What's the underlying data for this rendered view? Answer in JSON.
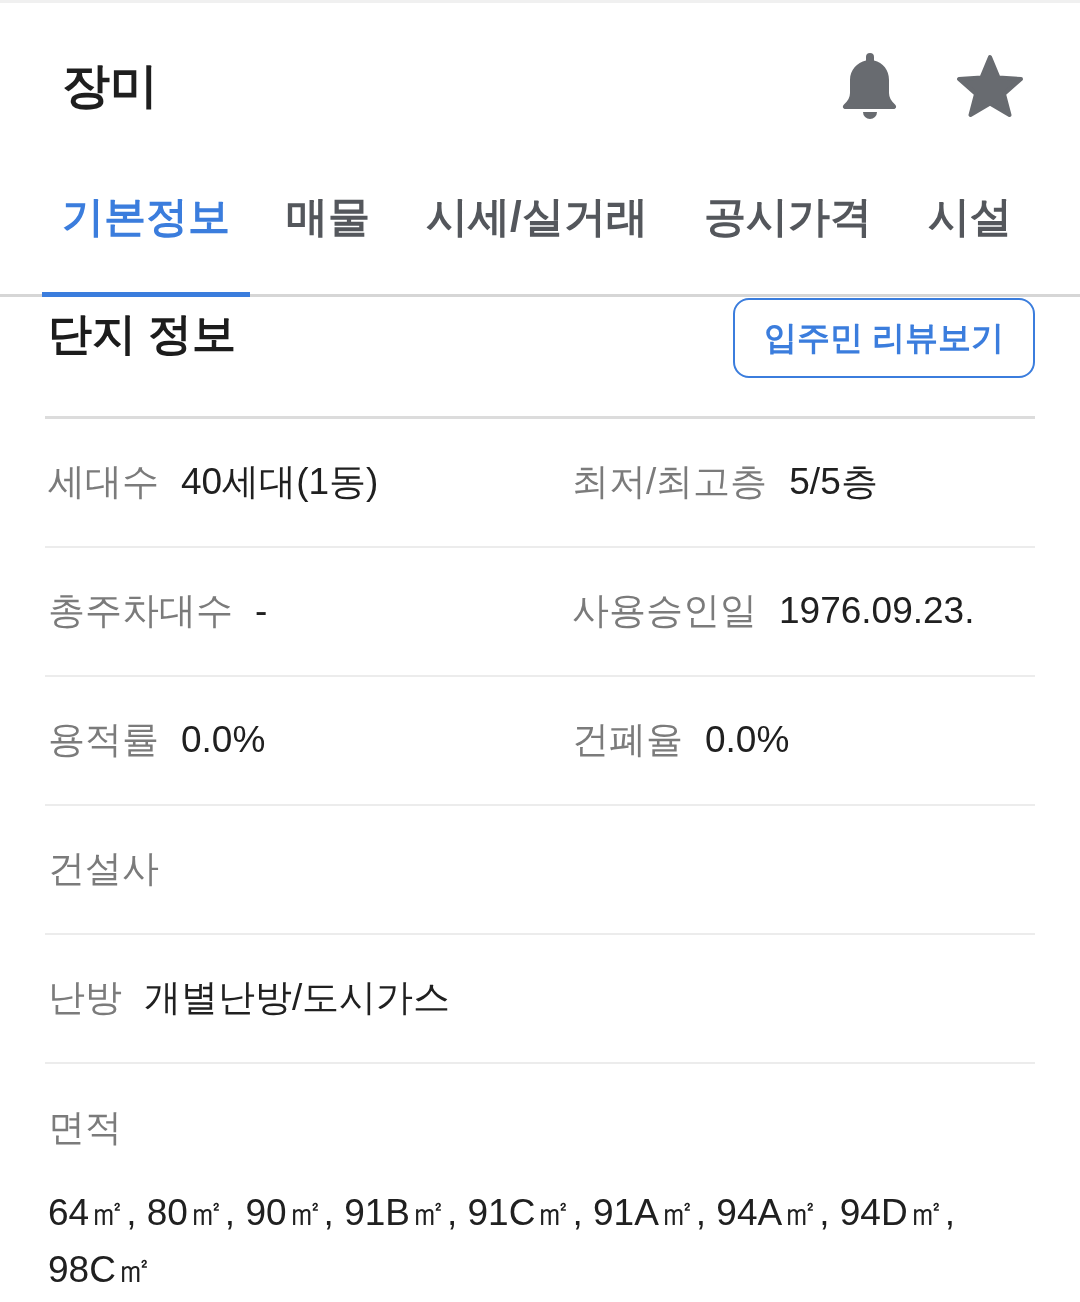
{
  "header": {
    "title": "장미"
  },
  "tabs": [
    {
      "label": "기본정보",
      "selected": true
    },
    {
      "label": "매물",
      "selected": false
    },
    {
      "label": "시세/실거래",
      "selected": false
    },
    {
      "label": "공시가격",
      "selected": false
    },
    {
      "label": "시설",
      "selected": false
    }
  ],
  "section": {
    "title": "단지 정보",
    "review_button": "입주민 리뷰보기"
  },
  "info_rows": [
    {
      "kind": "inline",
      "items": [
        {
          "label": "세대수",
          "value": "40세대(1동)"
        },
        {
          "label": "최저/최고층",
          "value": "5/5층"
        }
      ]
    },
    {
      "kind": "inline",
      "items": [
        {
          "label": "총주차대수",
          "value": "-"
        },
        {
          "label": "사용승인일",
          "value": "1976.09.23."
        }
      ]
    },
    {
      "kind": "inline",
      "items": [
        {
          "label": "용적률",
          "value": "0.0%"
        },
        {
          "label": "건폐율",
          "value": "0.0%"
        }
      ]
    },
    {
      "kind": "inline",
      "items": [
        {
          "label": "건설사"
        }
      ]
    },
    {
      "kind": "inline",
      "items": [
        {
          "label": "난방",
          "value": "개별난방/도시가스"
        }
      ]
    },
    {
      "kind": "stacked",
      "items": [
        {
          "label": "면적",
          "value": "64㎡, 80㎡, 90㎡, 91B㎡, 91C㎡, 91A㎡, 94A㎡, 94D㎡, 98C㎡"
        }
      ]
    }
  ]
}
